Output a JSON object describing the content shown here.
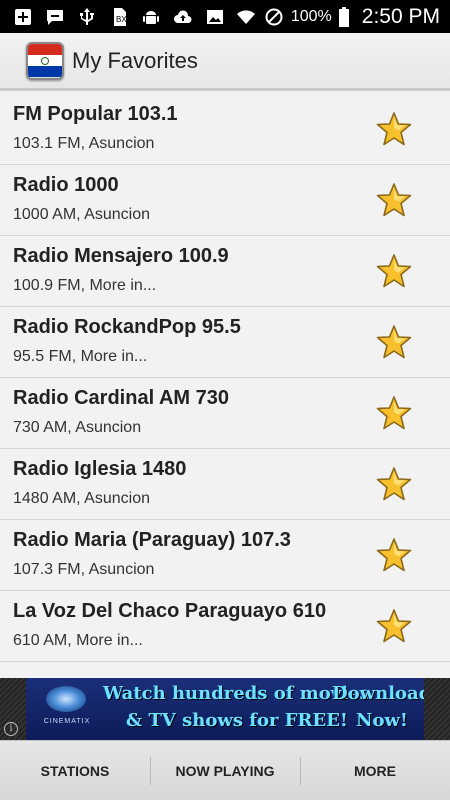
{
  "status_bar": {
    "left_icons": [
      "add-box-icon",
      "chat-icon",
      "usb-icon",
      "sim-icon",
      "android-icon",
      "cloud-upload-icon",
      "image-icon"
    ],
    "battery_percent": "100%",
    "time": "2:50 PM"
  },
  "action_bar": {
    "title": "My Favorites",
    "app_icon": "paraguay-flag-icon",
    "flag_colors": [
      "#d52b1e",
      "#ffffff",
      "#0038a8"
    ]
  },
  "stations": [
    {
      "name": "FM Popular 103.1",
      "detail": "103.1 FM, Asuncion"
    },
    {
      "name": "Radio 1000",
      "detail": "1000 AM, Asuncion"
    },
    {
      "name": "Radio Mensajero 100.9",
      "detail": "100.9 FM, More in..."
    },
    {
      "name": "Radio RockandPop 95.5",
      "detail": "95.5 FM, More in..."
    },
    {
      "name": "Radio Cardinal AM 730",
      "detail": "730 AM, Asuncion"
    },
    {
      "name": "Radio Iglesia 1480",
      "detail": "1480 AM, Asuncion"
    },
    {
      "name": "Radio Maria (Paraguay) 107.3",
      "detail": "107.3 FM, Asuncion"
    },
    {
      "name": "La Voz Del Chaco Paraguayo 610",
      "detail": "610 AM, More in..."
    }
  ],
  "ad": {
    "brand": "CINEMATIX",
    "line1": "Watch hundreds of movies",
    "line2": "& TV shows for FREE!",
    "cta1": "Download",
    "cta2": "Now!",
    "info": "i"
  },
  "tabs": [
    {
      "label": "STATIONS"
    },
    {
      "label": "NOW PLAYING"
    },
    {
      "label": "MORE"
    }
  ],
  "colors": {
    "star_fill": "#f7c02c",
    "star_stroke": "#8a6a1a",
    "ad_text": "#6fe0ff"
  }
}
